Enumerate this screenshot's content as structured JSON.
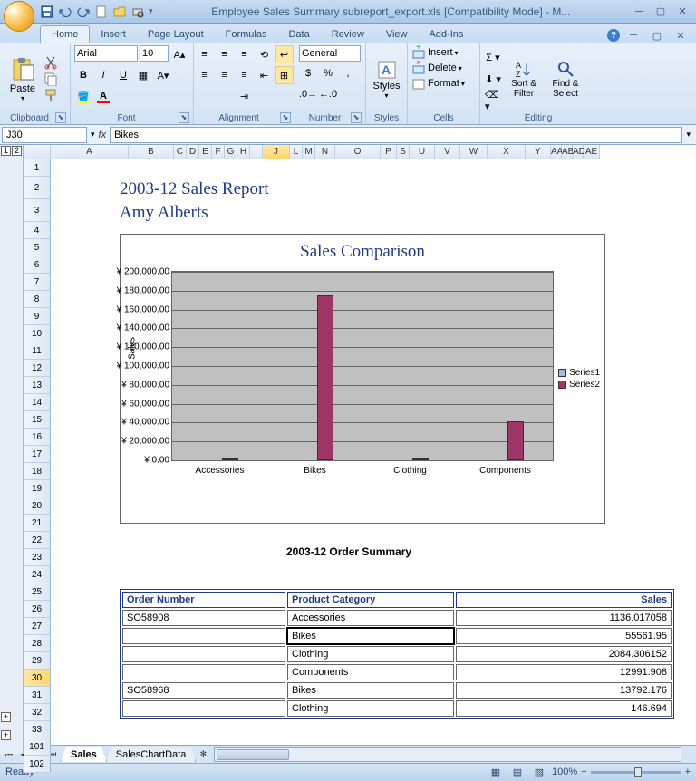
{
  "title": "Employee Sales Summary subreport_export.xls [Compatibility Mode] - M...",
  "tabs": [
    "Home",
    "Insert",
    "Page Layout",
    "Formulas",
    "Data",
    "Review",
    "View",
    "Add-Ins"
  ],
  "ribbon": {
    "clipboard": {
      "label": "Clipboard",
      "paste": "Paste"
    },
    "font": {
      "label": "Font",
      "name": "Arial",
      "size": "10"
    },
    "alignment": {
      "label": "Alignment"
    },
    "number": {
      "label": "Number",
      "format": "General"
    },
    "styles": {
      "label": "Styles",
      "btn": "Styles"
    },
    "cells": {
      "label": "Cells",
      "insert": "Insert",
      "delete": "Delete",
      "format": "Format"
    },
    "editing": {
      "label": "Editing",
      "sort": "Sort & Filter",
      "find": "Find & Select"
    }
  },
  "namebox": "J30",
  "formula": "Bikes",
  "cols_pre": [
    "1",
    "2"
  ],
  "cols": [
    {
      "l": "A",
      "w": 86
    },
    {
      "l": "B",
      "w": 50
    },
    {
      "l": "C",
      "w": 14
    },
    {
      "l": "D",
      "w": 14
    },
    {
      "l": "E",
      "w": 14
    },
    {
      "l": "F",
      "w": 14
    },
    {
      "l": "G",
      "w": 14
    },
    {
      "l": "H",
      "w": 14
    },
    {
      "l": "I",
      "w": 14
    },
    {
      "l": "J",
      "w": 30,
      "sel": true
    },
    {
      "l": "L",
      "w": 14
    },
    {
      "l": "M",
      "w": 14
    },
    {
      "l": "N",
      "w": 22
    },
    {
      "l": "O",
      "w": 50
    },
    {
      "l": "P",
      "w": 18
    },
    {
      "l": "S",
      "w": 14
    },
    {
      "l": "U",
      "w": 28
    },
    {
      "l": "V",
      "w": 28
    },
    {
      "l": "W",
      "w": 30
    },
    {
      "l": "X",
      "w": 42
    },
    {
      "l": "Y",
      "w": 28
    },
    {
      "l": "AA",
      "w": 12
    },
    {
      "l": "AB",
      "w": 12
    },
    {
      "l": "AD",
      "w": 12
    },
    {
      "l": "AE",
      "w": 18
    }
  ],
  "rows": [
    1,
    2,
    3,
    4,
    5,
    6,
    7,
    8,
    9,
    10,
    11,
    12,
    13,
    14,
    15,
    16,
    17,
    18,
    19,
    20,
    21,
    22,
    23,
    24,
    25,
    26,
    27,
    28,
    29,
    30,
    31,
    32,
    33,
    101,
    102
  ],
  "sel_row": 30,
  "report": {
    "title": "2003-12 Sales Report",
    "name": "Amy Alberts",
    "summary": "2003-12 Order Summary"
  },
  "chart_data": {
    "type": "bar",
    "title": "Sales Comparison",
    "ylabel": "Sales",
    "categories": [
      "Accessories",
      "Bikes",
      "Clothing",
      "Components"
    ],
    "series": [
      {
        "name": "Series1",
        "values": [
          0,
          0,
          0,
          0
        ]
      },
      {
        "name": "Series2",
        "values": [
          1136,
          175000,
          2084,
          41000
        ]
      }
    ],
    "ylim": [
      0,
      200000
    ],
    "ytick_step": 20000,
    "currency": "¥"
  },
  "table": {
    "headers": [
      "Order Number",
      "Product Category",
      "Sales"
    ],
    "rows": [
      {
        "order": "SO58908",
        "cat": "Accessories",
        "sales": "1136.017058"
      },
      {
        "order": "",
        "cat": "Bikes",
        "sales": "55561.95",
        "sel": true
      },
      {
        "order": "",
        "cat": "Clothing",
        "sales": "2084.306152"
      },
      {
        "order": "",
        "cat": "Components",
        "sales": "12991.908"
      },
      {
        "order": "SO58968",
        "cat": "Bikes",
        "sales": "13792.176"
      },
      {
        "order": "",
        "cat": "Clothing",
        "sales": "146.694"
      }
    ]
  },
  "sheets": [
    "Sales",
    "SalesChartData"
  ],
  "active_sheet": 0,
  "status": "Ready",
  "zoom": "100%"
}
